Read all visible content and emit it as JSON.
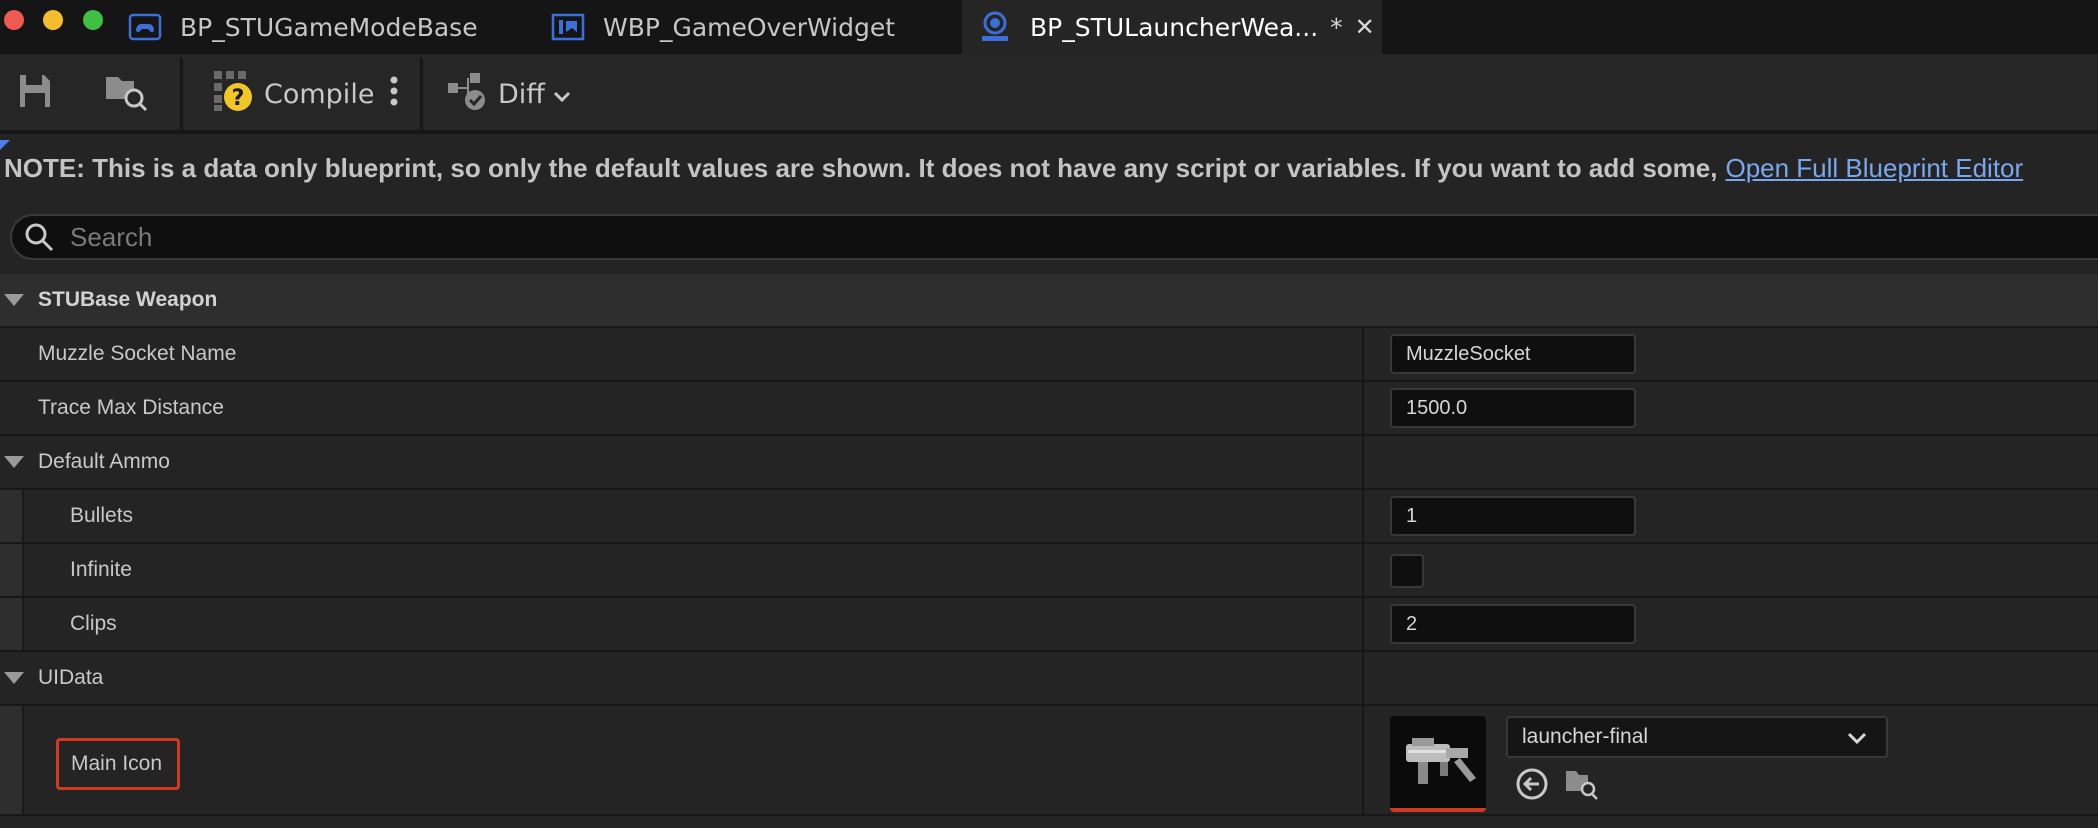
{
  "window": {
    "tabs": [
      {
        "label": "BP_STUGameModeBase",
        "icon": "gamepad-icon"
      },
      {
        "label": "WBP_GameOverWidget",
        "icon": "widget-blueprint-icon"
      },
      {
        "label": "BP_STULauncherWea...",
        "icon": "actor-blueprint-icon",
        "dirty": "*",
        "active": true
      }
    ]
  },
  "toolbar": {
    "save_icon": "save-icon",
    "browse_icon": "browse-icon",
    "compile_label": "Compile",
    "compile_icon": "compile-unknown-icon",
    "more_icon": "kebab-menu-icon",
    "diff_label": "Diff"
  },
  "note": {
    "text": "NOTE: This is a data only blueprint, so only the default values are shown.  It does not have any script or variables.  If you want to add some,",
    "link": "Open Full Blueprint Editor"
  },
  "search": {
    "placeholder": "Search",
    "value": ""
  },
  "details": {
    "category_base": "STUBase Weapon",
    "muzzle_socket_name": {
      "label": "Muzzle Socket Name",
      "value": "MuzzleSocket"
    },
    "trace_max_distance": {
      "label": "Trace Max Distance",
      "value": "1500.0"
    },
    "category_ammo": "Default Ammo",
    "bullets": {
      "label": "Bullets",
      "value": "1"
    },
    "infinite": {
      "label": "Infinite",
      "checked": false
    },
    "clips": {
      "label": "Clips",
      "value": "2"
    },
    "category_uidata": "UIData",
    "main_icon": {
      "label": "Main Icon",
      "asset": "launcher-final"
    }
  },
  "colors": {
    "accent_blue": "#4a7ff0",
    "link": "#7aa8ef",
    "highlight_red": "#d03a23",
    "panel": "#242424",
    "category": "#2e2e2e"
  }
}
